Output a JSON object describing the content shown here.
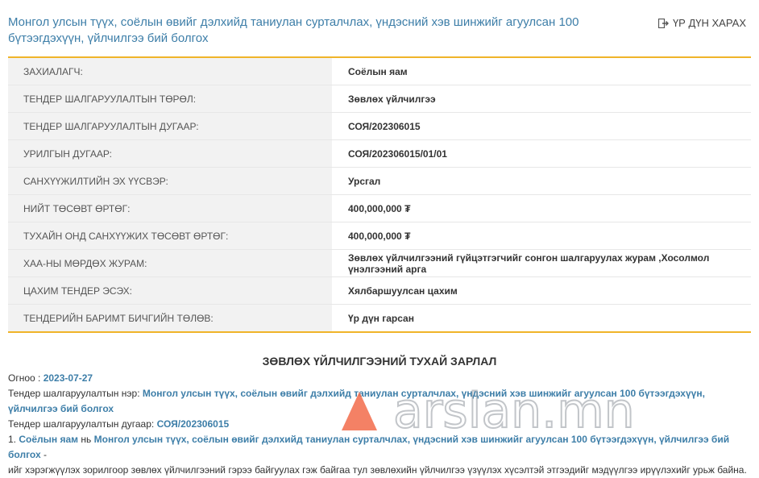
{
  "header": {
    "title": "Монгол улсын түүх, соёлын өвийг дэлхийд таниулан сурталчлах, үндэсний хэв шинжийг агуулсан 100 бүтээгдэхүүн, үйлчилгээ бий болгох",
    "back_label": "ҮР ДҮН ХАРАХ",
    "back_icon": "exit-icon"
  },
  "details": [
    {
      "label": "ЗАХИАЛАГЧ:",
      "value": "Соёлын яам"
    },
    {
      "label": "ТЕНДЕР ШАЛГАРУУЛАЛТЫН ТӨРӨЛ:",
      "value": "Зөвлөх үйлчилгээ"
    },
    {
      "label": "ТЕНДЕР ШАЛГАРУУЛАЛТЫН ДУГААР:",
      "value": "СОЯ/202306015"
    },
    {
      "label": "УРИЛГЫН ДУГААР:",
      "value": "СОЯ/202306015/01/01"
    },
    {
      "label": "САНХҮҮЖИЛТИЙН ЭХ ҮҮСВЭР:",
      "value": "Урсгал"
    },
    {
      "label": "НИЙТ ТӨСӨВТ ӨРТӨГ:",
      "value": "400,000,000 ₮"
    },
    {
      "label": "ТУХАЙН ОНД САНХҮҮЖИХ ТӨСӨВТ ӨРТӨГ:",
      "value": "400,000,000 ₮"
    },
    {
      "label": "ХАА-НЫ МӨРДӨХ ЖУРАМ:",
      "value": "Зөвлөх үйлчилгээний гүйцэтгэгчийг сонгон шалгаруулах журам ,Хосолмол үнэлгээний арга"
    },
    {
      "label": "ЦАХИМ ТЕНДЕР ЭСЭХ:",
      "value": "Хялбаршуулсан цахим"
    },
    {
      "label": "ТЕНДЕРИЙН БАРИМТ БИЧГИЙН ТӨЛӨВ:",
      "value": "Үр дүн гарсан"
    }
  ],
  "announcement": {
    "title": "ЗӨВЛӨХ ҮЙЛЧИЛГЭЭНИЙ ТУХАЙ ЗАРЛАЛ",
    "date_label": "Огноо :",
    "date": "2023-07-27",
    "name_label": "Тендер шалгаруулалтын нэр:",
    "name": "Монгол улсын түүх, соёлын өвийг дэлхийд таниулан сурталчлах, үндэсний хэв шинжийг агуулсан 100 бүтээгдэхүүн, үйлчилгээ бий болгох",
    "number_label": "Тендер шалгаруулалтын дугаар:",
    "number": "СОЯ/202306015",
    "para_prefix": "1.",
    "para_org": "Соёлын яам",
    "para_mid": "нь",
    "para_project": "Монгол улсын түүх, соёлын өвийг дэлхийд таниулан сурталчлах, үндэсний хэв шинжийг агуулсан 100 бүтээгдэхүүн, үйлчилгээ бий болгох",
    "para_dash": " -",
    "para_rest": "ийг хэрэгжүүлэх зорилгоор зөвлөх үйлчилгээний гэрээ байгуулах гэж байгаа тул зөвлөхийн үйлчилгээ үзүүлэх хүсэлтэй этгээдийг мэдүүлгээ ирүүлэхийг урьж байна."
  },
  "watermark": {
    "text": "arslan.mn",
    "accent": "#f26b4a"
  },
  "colors": {
    "accent": "#f0b429",
    "link": "#3d7ea8",
    "row_bg": "#f2f2f2"
  }
}
